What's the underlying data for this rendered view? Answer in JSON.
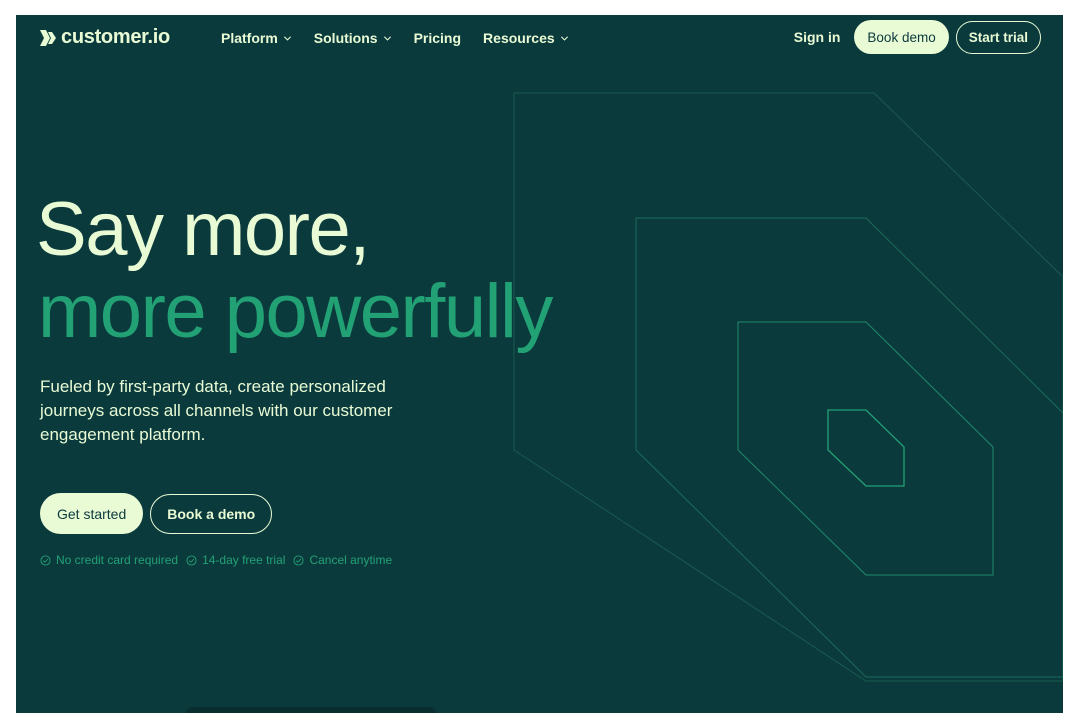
{
  "brand": {
    "name": "customer.io",
    "logo_icon": "double-chevron-logo-icon"
  },
  "nav": {
    "items": [
      {
        "label": "Platform",
        "has_dropdown": true
      },
      {
        "label": "Solutions",
        "has_dropdown": true
      },
      {
        "label": "Pricing",
        "has_dropdown": false
      },
      {
        "label": "Resources",
        "has_dropdown": true
      }
    ],
    "sign_in": "Sign in",
    "book_demo": "Book demo",
    "start_trial": "Start trial"
  },
  "hero": {
    "headline_line1": "Say more,",
    "headline_line2": "more powerfully",
    "subheadline": "Fueled by first-party data, create personalized journeys across all channels with our customer engagement platform.",
    "primary_cta": "Get started",
    "secondary_cta": "Book a demo",
    "perks": [
      "No credit card required",
      "14-day free trial",
      "Cancel anytime"
    ]
  },
  "colors": {
    "background": "#0b3a3d",
    "cream": "#e9fbd5",
    "accent_green": "#22a175"
  }
}
